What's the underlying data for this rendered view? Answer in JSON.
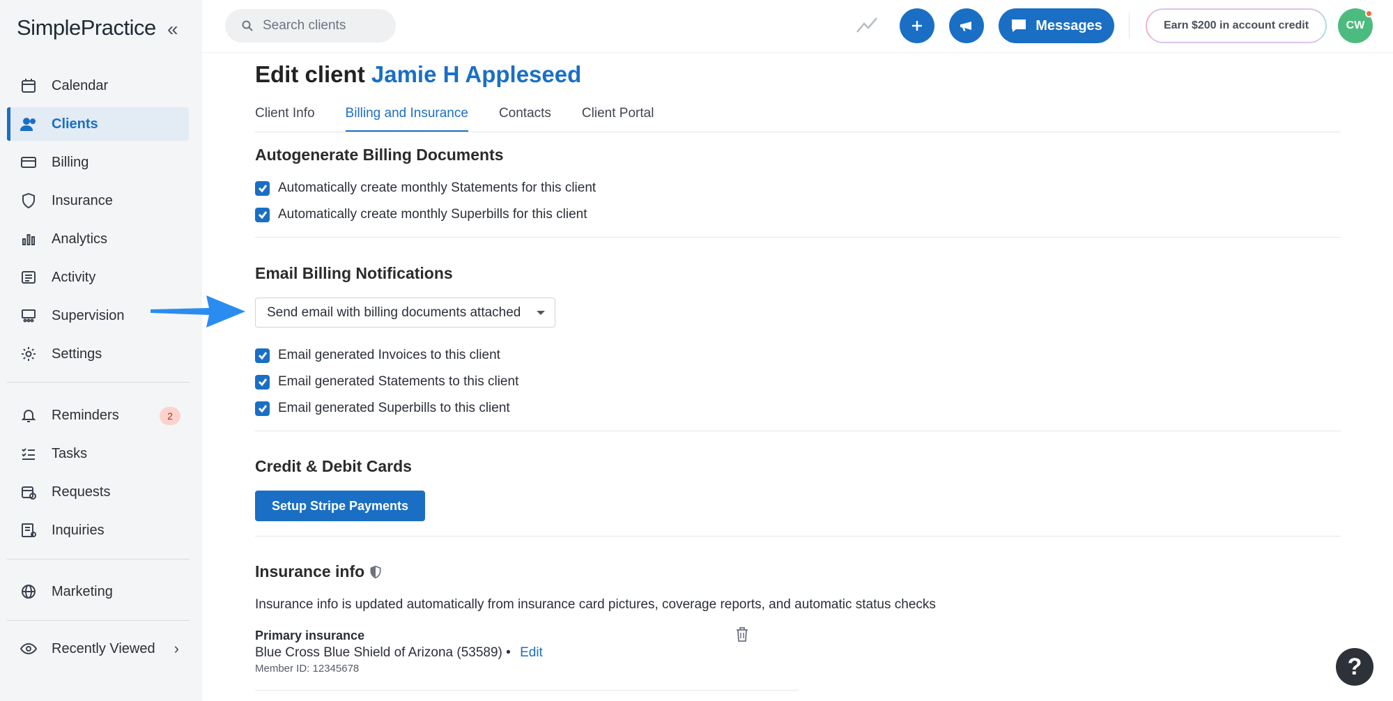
{
  "brand": {
    "logo_text": "SimplePractice",
    "collapse_glyph": "«"
  },
  "sidebar": {
    "items": [
      {
        "label": "Calendar",
        "icon": "calendar-icon"
      },
      {
        "label": "Clients",
        "icon": "users-icon",
        "active": true
      },
      {
        "label": "Billing",
        "icon": "credit-card-icon"
      },
      {
        "label": "Insurance",
        "icon": "shield-icon"
      },
      {
        "label": "Analytics",
        "icon": "bar-chart-icon"
      },
      {
        "label": "Activity",
        "icon": "list-icon"
      },
      {
        "label": "Supervision",
        "icon": "supervision-icon"
      },
      {
        "label": "Settings",
        "icon": "gear-icon"
      },
      {
        "label": "Reminders",
        "icon": "bell-icon",
        "badge": "2"
      },
      {
        "label": "Tasks",
        "icon": "tasks-icon"
      },
      {
        "label": "Requests",
        "icon": "calendar-plus-icon"
      },
      {
        "label": "Inquiries",
        "icon": "inquiries-icon"
      },
      {
        "label": "Marketing",
        "icon": "globe-icon"
      },
      {
        "label": "Recently Viewed",
        "icon": "eye-icon"
      }
    ]
  },
  "header": {
    "search_placeholder": "Search clients",
    "messages_label": "Messages",
    "earn_label": "Earn $200 in account credit",
    "avatar_initials": "CW"
  },
  "page": {
    "title_prefix": "Edit client",
    "client_name": "Jamie H Appleseed",
    "tabs": [
      "Client Info",
      "Billing and Insurance",
      "Contacts",
      "Client Portal"
    ],
    "active_tab": "Billing and Insurance"
  },
  "autogenerate": {
    "title": "Autogenerate Billing Documents",
    "options": [
      "Automatically create monthly Statements for this client",
      "Automatically create monthly Superbills for this client"
    ]
  },
  "email_notifications": {
    "title": "Email Billing Notifications",
    "select_value": "Send email with billing documents attached",
    "options": [
      "Email generated Invoices to this client",
      "Email generated Statements to this client",
      "Email generated Superbills to this client"
    ]
  },
  "cards": {
    "title": "Credit & Debit Cards",
    "button_label": "Setup Stripe Payments"
  },
  "insurance": {
    "title": "Insurance info",
    "description": "Insurance info is updated automatically from insurance card pictures, coverage reports, and automatic status checks",
    "primary_label": "Primary insurance",
    "primary_value": "Blue Cross Blue Shield of Arizona (53589) •",
    "edit_label": "Edit",
    "member_id": "Member ID: 12345678"
  },
  "help_glyph": "?",
  "colors": {
    "accent": "#1a6fc4",
    "arrow": "#2a8cf0",
    "avatar": "#4cbb7f"
  }
}
